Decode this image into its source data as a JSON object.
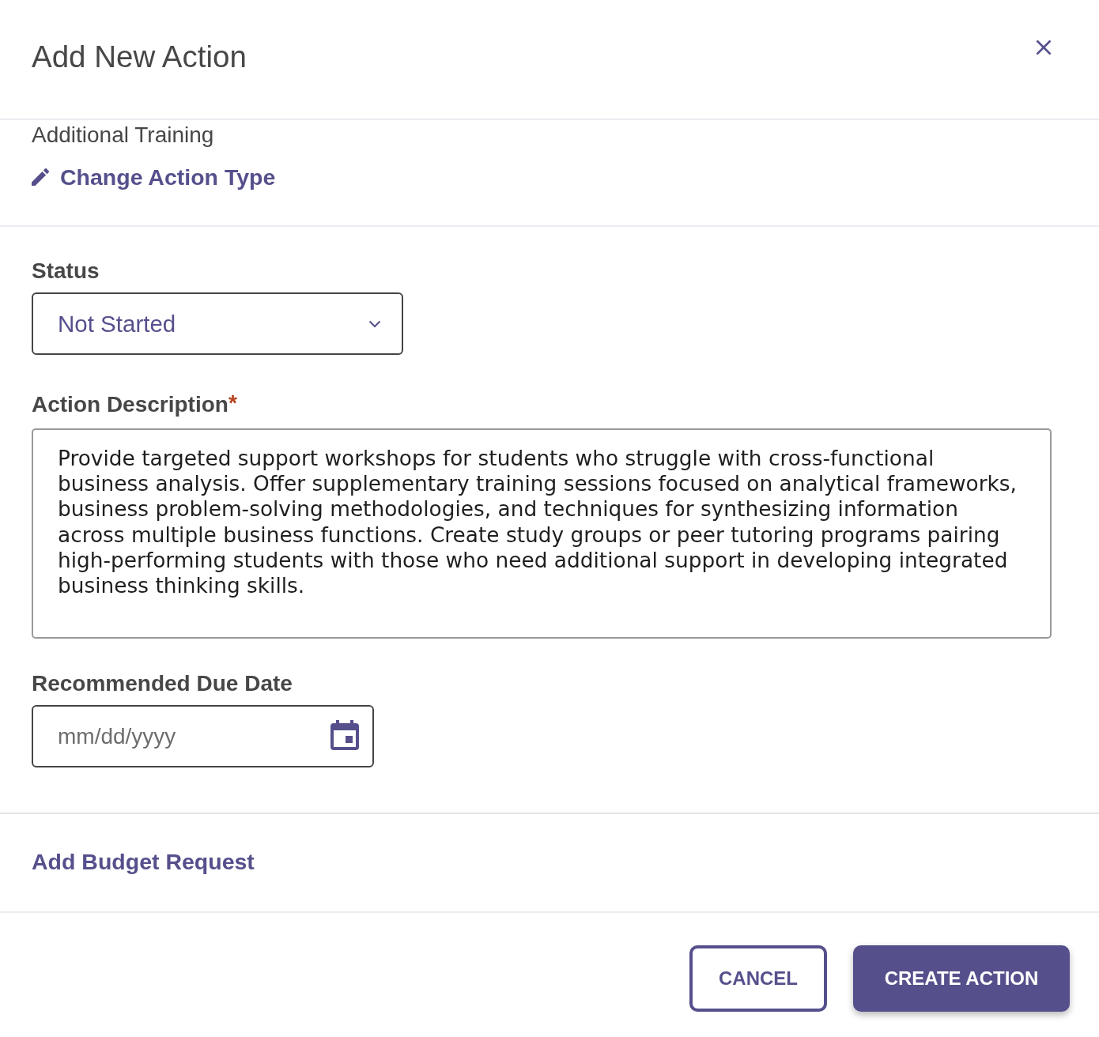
{
  "dialog": {
    "title": "Add New Action"
  },
  "action_type": {
    "name": "Additional Training",
    "change_link": "Change Action Type"
  },
  "form": {
    "fields": [
      {
        "kind": "select",
        "label": "Status",
        "value": "Not Started"
      },
      {
        "kind": "textarea",
        "label": "Action Description",
        "required_mark": "*",
        "value": "Provide targeted support workshops for students who struggle with cross-functional business analysis. Offer supplementary training sessions focused on analytical frameworks, business problem-solving methodologies, and techniques for synthesizing information across multiple business functions. Create study groups or peer tutoring programs pairing high-performing students with those who need additional support in developing integrated business thinking skills."
      },
      {
        "kind": "date",
        "label": "Recommended Due Date",
        "placeholder": "mm/dd/yyyy"
      }
    ]
  },
  "budget_link": "Add Budget Request",
  "buttons": [
    {
      "kind": "secondary",
      "label": "CANCEL"
    },
    {
      "kind": "primary",
      "label": "CREATE ACTION"
    }
  ]
}
